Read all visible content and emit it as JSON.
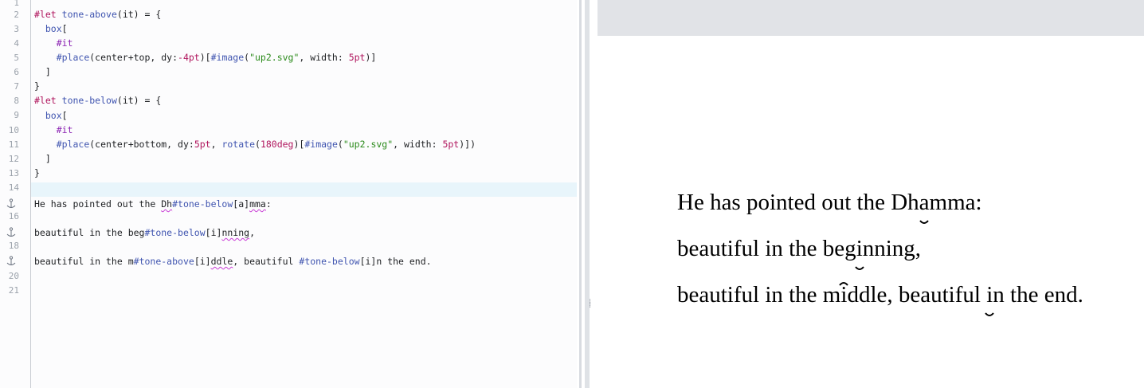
{
  "editor": {
    "line_numbers": [
      "1",
      "2",
      "3",
      "4",
      "5",
      "6",
      "7",
      "8",
      "9",
      "10",
      "11",
      "12",
      "13",
      "14",
      "",
      "16",
      "",
      "18",
      "",
      "20",
      "21"
    ],
    "lines": {
      "l2": {
        "t1": "#let",
        "t2": " ",
        "t3": "tone-above",
        "t4": "(it) = {"
      },
      "l3": {
        "t1": "  ",
        "t2": "box",
        "t3": "["
      },
      "l4": {
        "t1": "    ",
        "t2": "#it"
      },
      "l5": {
        "t1": "    ",
        "t2": "#place",
        "t3": "(center+top, dy:",
        "t4": "-4pt",
        "t5": ")[",
        "t6": "#image",
        "t7": "(",
        "t8": "\"up2.svg\"",
        "t9": ", width: ",
        "t10": "5pt",
        "t11": ")]"
      },
      "l6": "  ]",
      "l7": "}",
      "l8": {
        "t1": "#let",
        "t2": " ",
        "t3": "tone-below",
        "t4": "(it) = {"
      },
      "l9": {
        "t1": "  ",
        "t2": "box",
        "t3": "["
      },
      "l10": {
        "t1": "    ",
        "t2": "#it"
      },
      "l11": {
        "t1": "    ",
        "t2": "#place",
        "t3": "(center+bottom, dy:",
        "t4": "5pt",
        "t5": ", ",
        "t6": "rotate",
        "t7": "(",
        "t8": "180deg",
        "t9": ")[",
        "t10": "#image",
        "t11": "(",
        "t12": "\"up2.svg\"",
        "t13": ", width: ",
        "t14": "5pt",
        "t15": ")])"
      },
      "l12": "  ]",
      "l13": "}",
      "l15": {
        "a": "He has pointed out the ",
        "b": "Dh",
        "c": "#tone-below",
        "d": "[a]",
        "e": "mma",
        ":": ":"
      },
      "l17": {
        "a": "beautiful in the ",
        "b": "beg",
        "c": "#tone-below",
        "d": "[i]",
        "e": "nning",
        ":": ","
      },
      "l19": {
        "a": "beautiful in the ",
        "b": "m",
        "c": "#tone-above",
        "d": "[i]",
        "e": "ddle",
        ":": ", beautiful ",
        "f": "#tone-below",
        "g": "[i]",
        "h": "n the end."
      }
    }
  },
  "preview": {
    "line1": {
      "a": "He has pointed out the Dh",
      "b": "a",
      "c": "mma:"
    },
    "line2": {
      "a": "beautiful in the beg",
      "b": "i",
      "c": "nning,"
    },
    "line3": {
      "a": "beautiful in the m",
      "b": "i",
      "c": "ddle, beautiful ",
      "d": "i",
      "e": "n the end."
    }
  },
  "icons": {
    "gutter": "anchor-icon",
    "grip": "drag-handle-icon"
  },
  "colors": {
    "keyword": "#b0155d",
    "function": "#4055b0",
    "hash": "#8a21b2",
    "string": "#2a8a1a",
    "highlight": "#e8f5fb"
  }
}
